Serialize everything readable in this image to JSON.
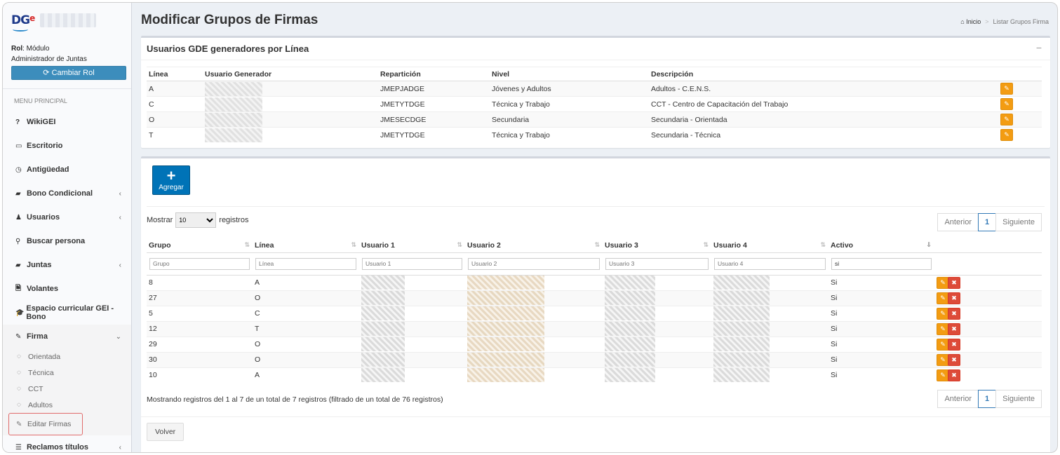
{
  "app": {
    "logo_text": "DG",
    "logo_accent": "e",
    "brand_color": "#3c8dbc"
  },
  "user": {
    "rol_label": "Rol",
    "rol_value": ": Módulo",
    "rol_line2": "Administrador de Juntas",
    "change_role_label": "Cambiar Rol"
  },
  "sidebar": {
    "header": "MENU PRINCIPAL",
    "items": [
      {
        "label": "WikiGEI",
        "icon": "question-icon",
        "glyph": "?"
      },
      {
        "label": "Escritorio",
        "icon": "laptop-icon",
        "glyph": "▭"
      },
      {
        "label": "Antigüedad",
        "icon": "clock-icon",
        "glyph": "◷"
      },
      {
        "label": "Bono Condicional",
        "icon": "book-icon",
        "glyph": "▰"
      },
      {
        "label": "Usuarios",
        "icon": "user-icon",
        "glyph": "♟"
      },
      {
        "label": "Buscar persona",
        "icon": "search-icon",
        "glyph": "⚲"
      },
      {
        "label": "Juntas",
        "icon": "book-icon",
        "glyph": "▰"
      },
      {
        "label": "Volantes",
        "icon": "file-icon",
        "glyph": "🗎"
      },
      {
        "label": "Espacio curricular GEI - Bono",
        "icon": "graduation-cap-icon",
        "glyph": "🎓"
      },
      {
        "label": "Firma",
        "icon": "pencil-icon",
        "glyph": "✎"
      }
    ],
    "firma_sub": [
      {
        "label": "Orientada"
      },
      {
        "label": "Técnica"
      },
      {
        "label": "CCT"
      },
      {
        "label": "Adultos"
      },
      {
        "label": "Editar Firmas"
      }
    ],
    "last_item": {
      "label": "Reclamos títulos",
      "glyph": "☰"
    }
  },
  "page": {
    "title": "Modificar Grupos de Firmas",
    "breadcrumb_home": "Inicio",
    "breadcrumb_current": "Listar Grupos Firma"
  },
  "generators": {
    "title": "Usuarios GDE generadores por Línea",
    "collapse": "−",
    "headers": [
      "Línea",
      "Usuario Generador",
      "Repartición",
      "Nivel",
      "Descripción"
    ],
    "rows": [
      {
        "linea": "A",
        "reparticion": "JMEPJADGE",
        "nivel": "Jóvenes y Adultos",
        "descripcion": "Adultos - C.E.N.S."
      },
      {
        "linea": "C",
        "reparticion": "JMETYTDGE",
        "nivel": "Técnica y Trabajo",
        "descripcion": "CCT - Centro de Capacitación del Trabajo"
      },
      {
        "linea": "O",
        "reparticion": "JMESECDGE",
        "nivel": "Secundaria",
        "descripcion": "Secundaria - Orientada"
      },
      {
        "linea": "T",
        "reparticion": "JMETYTDGE",
        "nivel": "Técnica y Trabajo",
        "descripcion": "Secundaria - Técnica"
      }
    ]
  },
  "groups": {
    "add_label": "Agregar",
    "show_label": "Mostrar",
    "show_value": "10",
    "records_label": "registros",
    "pager": {
      "prev": "Anterior",
      "page": "1",
      "next": "Siguiente"
    },
    "headers": [
      "Grupo",
      "Línea",
      "Usuario 1",
      "Usuario 2",
      "Usuario 3",
      "Usuario 4",
      "Activo"
    ],
    "filters": {
      "grupo": "Grupo",
      "linea": "Línea",
      "u1": "Usuario 1",
      "u2": "Usuario 2",
      "u3": "Usuario 3",
      "u4": "Usuario 4",
      "activo_value": "si"
    },
    "rows": [
      {
        "grupo": "8",
        "linea": "A",
        "activo": "Si"
      },
      {
        "grupo": "27",
        "linea": "O",
        "activo": "Si"
      },
      {
        "grupo": "5",
        "linea": "C",
        "activo": "Si"
      },
      {
        "grupo": "12",
        "linea": "T",
        "activo": "Si"
      },
      {
        "grupo": "29",
        "linea": "O",
        "activo": "Si"
      },
      {
        "grupo": "30",
        "linea": "O",
        "activo": "Si"
      },
      {
        "grupo": "10",
        "linea": "A",
        "activo": "Si"
      }
    ],
    "info": "Mostrando registros del 1 al 7 de un total de 7 registros (filtrado de un total de 76 registros)",
    "back_label": "Volver"
  }
}
